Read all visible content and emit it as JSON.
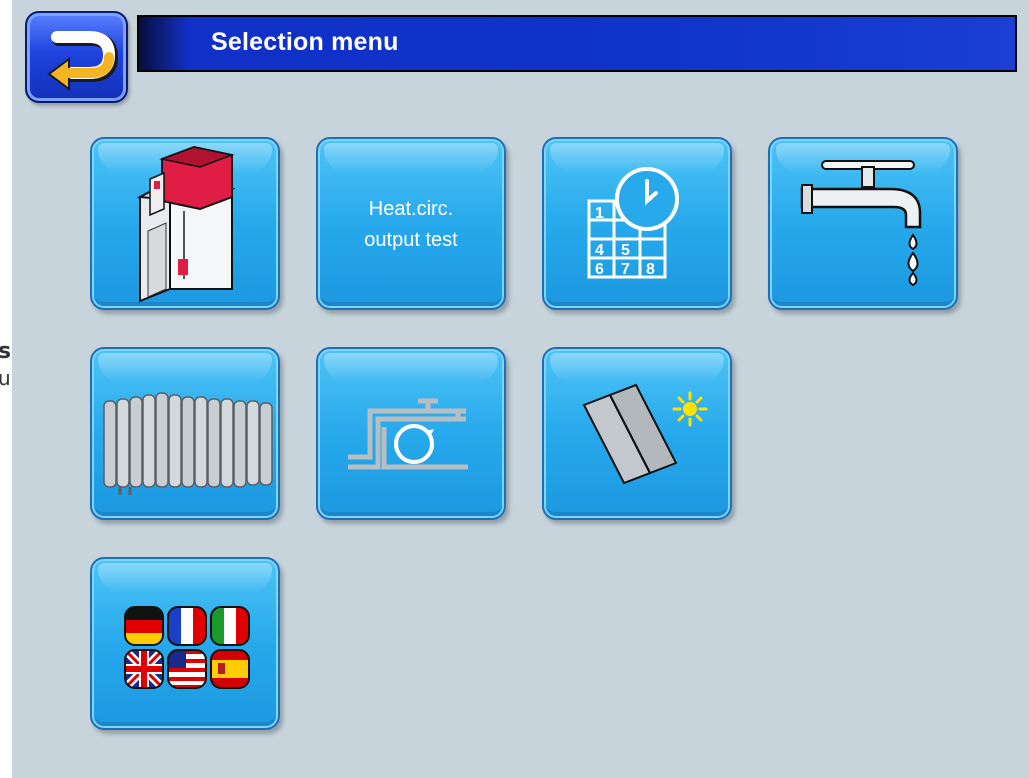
{
  "stray_text": {
    "line1": "s",
    "line2": "u"
  },
  "header": {
    "title": "Selection menu",
    "back_icon": "back-arrow-icon"
  },
  "tiles": [
    {
      "icon": "boiler-icon"
    },
    {
      "label_line1": "Heat.circ.",
      "label_line2": "output test"
    },
    {
      "icon": "calendar-clock-icon",
      "calendar_numbers": [
        "1",
        "4",
        "5",
        "6",
        "7",
        "8"
      ]
    },
    {
      "icon": "water-tap-icon"
    },
    {
      "icon": "radiator-icon"
    },
    {
      "icon": "circulation-pump-icon"
    },
    {
      "icon": "solar-collector-icon"
    },
    {
      "icon": "language-flags-icon"
    }
  ],
  "colors": {
    "screen_bg": "#c7d4dc",
    "title_bar": "#0f34c8",
    "tile": "#27a9ec",
    "back_arrow": "#f6b422"
  }
}
